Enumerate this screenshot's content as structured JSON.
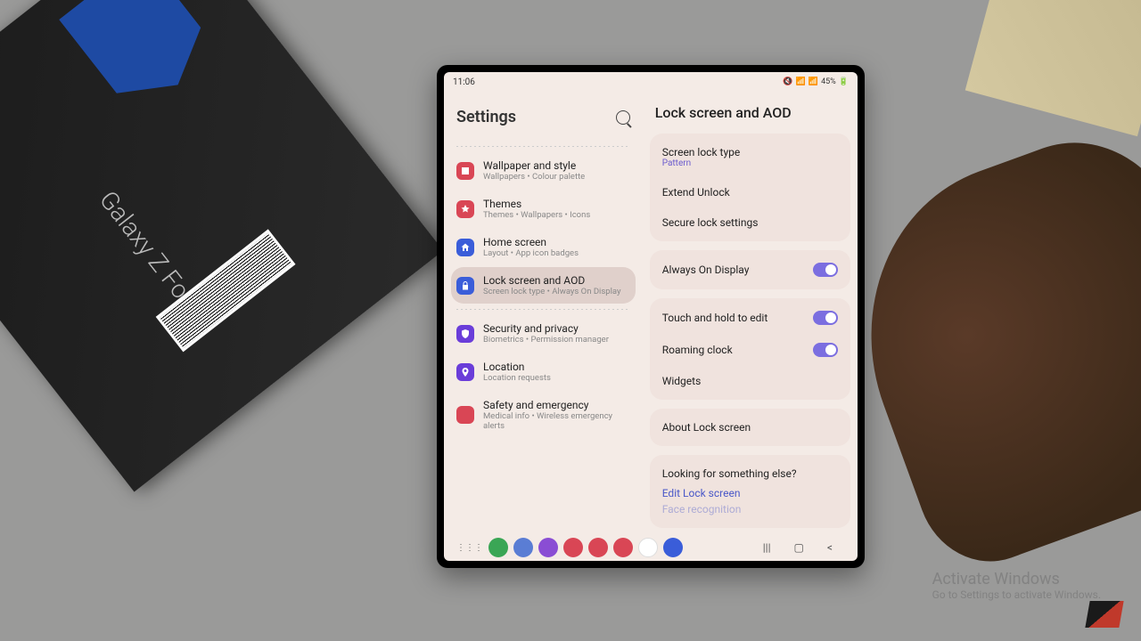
{
  "statusbar": {
    "time": "11:06",
    "battery": "45%"
  },
  "settings": {
    "title": "Settings"
  },
  "nav": {
    "wallpaper": {
      "title": "Wallpaper and style",
      "sub": "Wallpapers  •  Colour palette"
    },
    "themes": {
      "title": "Themes",
      "sub": "Themes  •  Wallpapers  •  Icons"
    },
    "home": {
      "title": "Home screen",
      "sub": "Layout  •  App icon badges"
    },
    "lock": {
      "title": "Lock screen and AOD",
      "sub": "Screen lock type  •  Always On Display"
    },
    "security": {
      "title": "Security and privacy",
      "sub": "Biometrics  •  Permission manager"
    },
    "location": {
      "title": "Location",
      "sub": "Location requests"
    },
    "safety": {
      "title": "Safety and emergency",
      "sub": "Medical info  •  Wireless emergency alerts"
    }
  },
  "detail": {
    "title": "Lock screen and AOD",
    "screenlock": {
      "title": "Screen lock type",
      "value": "Pattern"
    },
    "extend": "Extend Unlock",
    "secure": "Secure lock settings",
    "aod": "Always On Display",
    "touch": "Touch and hold to edit",
    "roaming": "Roaming clock",
    "widgets": "Widgets",
    "about": "About Lock screen",
    "looking": "Looking for something else?",
    "editlock": "Edit Lock screen",
    "face": "Face recognition"
  },
  "watermark": {
    "title": "Activate Windows",
    "sub": "Go to Settings to activate Windows."
  }
}
